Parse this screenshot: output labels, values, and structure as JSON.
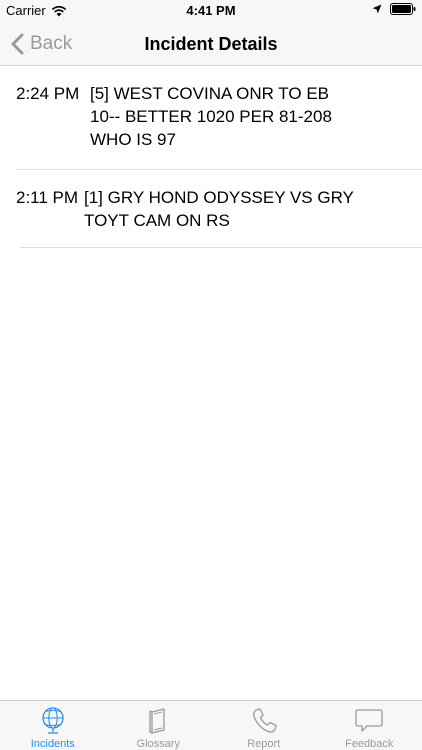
{
  "status_bar": {
    "carrier": "Carrier",
    "time": "4:41 PM",
    "icons": [
      "wifi-icon",
      "location-icon",
      "battery-icon"
    ]
  },
  "nav": {
    "back_label": "Back",
    "title": "Incident Details"
  },
  "incidents": [
    {
      "time": "2:24 PM",
      "text": "[5] WEST COVINA ONR TO EB 10-- BETTER 1020 PER 81-208 WHO IS 97"
    },
    {
      "time": "2:11 PM",
      "text": "[1] GRY HOND ODYSSEY VS GRY TOYT CAM ON RS"
    }
  ],
  "tabs": [
    {
      "label": "Incidents",
      "icon": "globe-icon",
      "active": true
    },
    {
      "label": "Glossary",
      "icon": "book-icon",
      "active": false
    },
    {
      "label": "Report",
      "icon": "phone-icon",
      "active": false
    },
    {
      "label": "Feedback",
      "icon": "speech-bubble-icon",
      "active": false
    }
  ],
  "colors": {
    "accent": "#2d8ce6",
    "inactive": "#9a9a9a",
    "bar_background": "#f7f7f7"
  }
}
